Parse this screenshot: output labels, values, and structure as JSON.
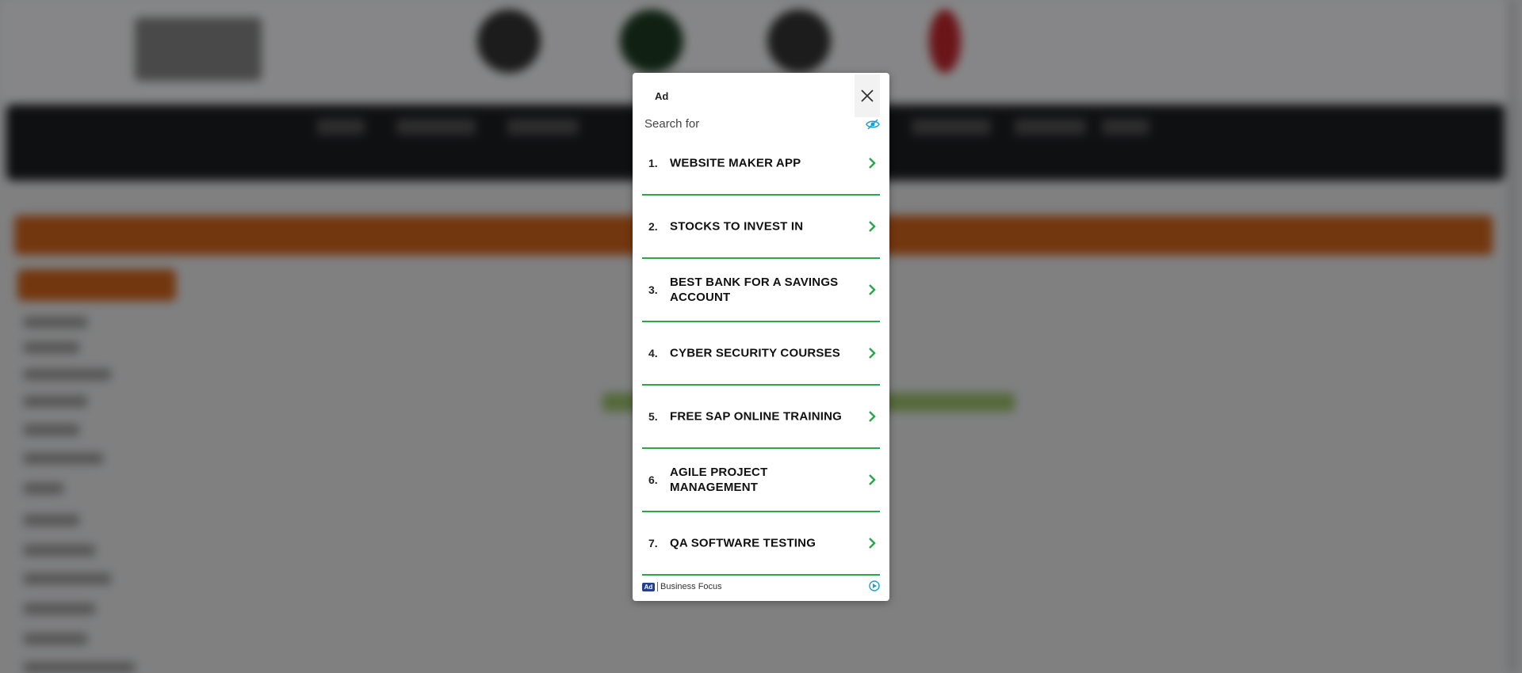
{
  "ad": {
    "label": "Ad",
    "search_for": "Search for",
    "results": [
      {
        "num": "1.",
        "text": "WEBSITE MAKER APP"
      },
      {
        "num": "2.",
        "text": "STOCKS TO INVEST IN"
      },
      {
        "num": "3.",
        "text": "BEST BANK FOR A SAVINGS ACCOUNT"
      },
      {
        "num": "4.",
        "text": "CYBER SECURITY COURSES"
      },
      {
        "num": "5.",
        "text": "FREE SAP ONLINE TRAINING"
      },
      {
        "num": "6.",
        "text": "AGILE PROJECT MANAGEMENT"
      },
      {
        "num": "7.",
        "text": "QA SOFTWARE TESTING"
      }
    ],
    "footer": {
      "badge": "Ad",
      "source": "Business Focus"
    },
    "colors": {
      "accent": "#2ba74b",
      "badge": "#24408e",
      "info_icon": "#1aa0d8"
    },
    "icons": {
      "close": "close-icon",
      "hide": "eye-slash-icon",
      "chevron": "chevron-right-icon",
      "adchoices": "adchoices-icon"
    }
  }
}
